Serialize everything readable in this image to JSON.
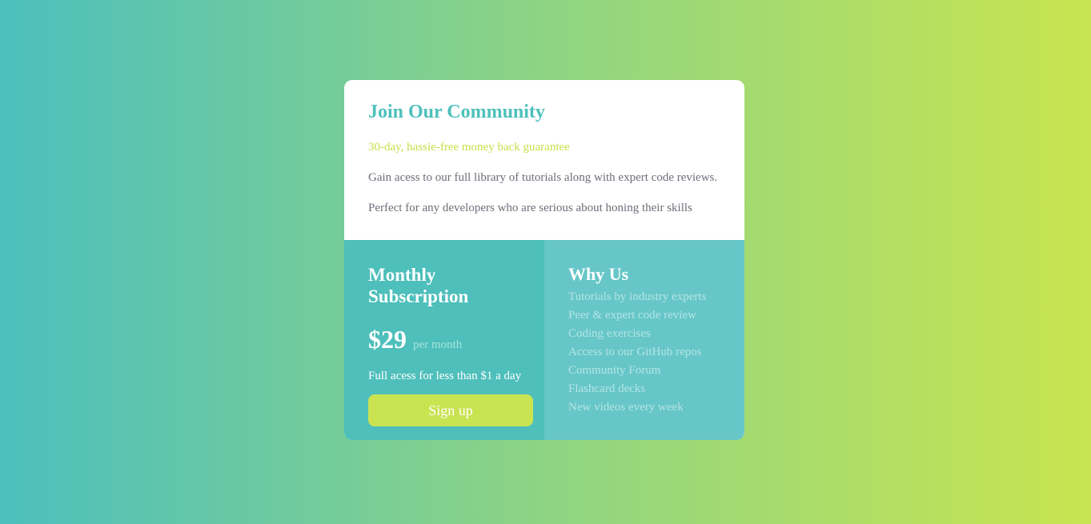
{
  "header": {
    "title": "Join Our Community",
    "guarantee": "30-day, hassie-free money back guarantee",
    "description_1": "Gain acess to our full library of tutorials along with expert code reviews.",
    "description_2": "Perfect for any developers who are serious about honing their skills"
  },
  "subscription": {
    "title": "Monthly Subscription",
    "price": "$29",
    "period": "per month",
    "note": "Full acess for less than $1 a day",
    "signup_label": "Sign up"
  },
  "why_us": {
    "title": "Why Us",
    "items": [
      "Tutorials by industry experts",
      "Peer & expert code review",
      "Coding exercises",
      "Access to our GitHub repos",
      "Community Forum",
      "Flashcard decks",
      "New videos every week"
    ]
  },
  "colors": {
    "accent_teal": "#4ebfbb",
    "accent_light_teal": "#67c6c8",
    "accent_lime": "#c9e351",
    "text_gray": "#6e6e7a"
  }
}
